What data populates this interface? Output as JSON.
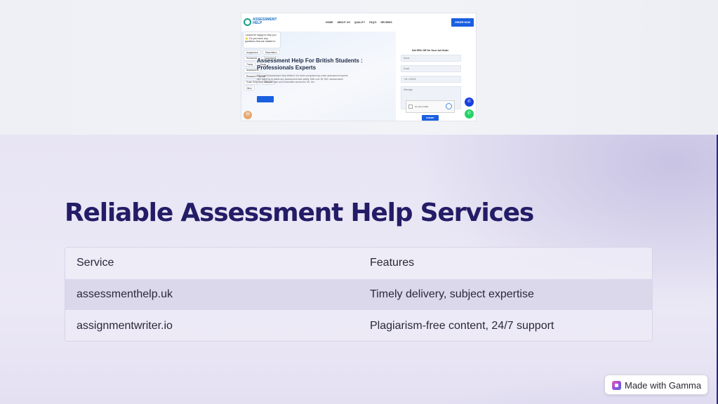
{
  "website": {
    "logo_text": "ASSESSMENT HELP",
    "nav_links": [
      "HOME",
      "ABOUT US",
      "QUALITY",
      "FAQ'S",
      "REVIEWS"
    ],
    "order_button": "ORDER NOW",
    "chat_message": "I would be happy to help you 👋. Do you have any questions that are related to",
    "chips": [
      "Assignment",
      "Dissertation",
      "Homework",
      "Coursework",
      "Thesis",
      "Essay",
      "Assessment",
      "Research Proposal",
      "Exam Help",
      "Sample",
      "Other"
    ],
    "hero_title": "Assessment Help For British Students : Professionals Experts",
    "hero_text": "Get expert Assessment Help Writers! Our team comprises top-notch assessment experts who stand by to tackle any assessment task swiftly. With over 45,780+ assessments delivered to colleges and universities across the UK, the",
    "form": {
      "title": "Get 50% Off On Your 1st Order",
      "name_placeholder": "Name",
      "email_placeholder": "Email",
      "phone_placeholder": "+44 ▾ 00000",
      "message_placeholder": "Message",
      "captcha_label": "I'm not a robot",
      "submit": "SUBMIT"
    }
  },
  "slide": {
    "title": "Reliable Assessment Help Services",
    "table": {
      "headers": [
        "Service",
        "Features"
      ],
      "rows": [
        [
          "assessmenthelp.uk",
          "Timely delivery, subject expertise"
        ],
        [
          "assignmentwriter.io",
          "Plagiarism-free content, 24/7 support"
        ]
      ]
    }
  },
  "badge": {
    "label": "Made with Gamma",
    "icon": "gamma-logo-icon"
  },
  "colors": {
    "title": "#231C66",
    "accent_blue": "#1A5FE0",
    "whatsapp": "#25D366"
  }
}
